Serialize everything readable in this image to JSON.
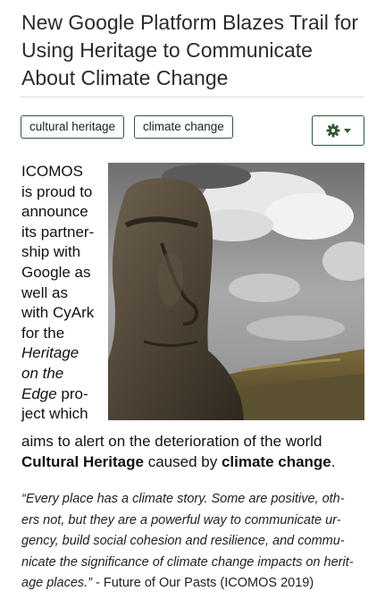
{
  "article": {
    "title": "New Google Platform Blazes Trail for Using Heritage to Communicate About Climate Change"
  },
  "tags": [
    {
      "label": "cultural heritage"
    },
    {
      "label": "climate change"
    }
  ],
  "settings_menu": {
    "icon": "gear-icon",
    "caret": "chevron-down-icon"
  },
  "body": {
    "line1": "ICOMOS",
    "line2": "is proud to",
    "line3": "announce",
    "line4": "its partner-",
    "line5": "ship with",
    "line6": "Google as",
    "line7": "well as",
    "line8": "with CyArk",
    "line9": "for the",
    "line10_em": "Heritage",
    "line11_em": "on the",
    "line12_em": "Edge",
    "line12_rest": " pro-",
    "line13": "ject which",
    "wide1": "aims to alert on the deterioration of the world",
    "bold1": "Cultural Heritage",
    "mid": " caused by ",
    "bold2": "climate change",
    "end": "."
  },
  "quote": {
    "text": "“Every place has a climate story. Some are positive, oth- ers not, but they are a powerful way to communicate ur- gency, build social cohesion and resilience, and commu- nicate the significance of climate change impacts on herit- age places.”",
    "l1": "“Every place has a climate story. Some are positive, oth-",
    "l2": "ers not, but they are a powerful way to communicate ur-",
    "l3": "gency, build social cohesion and resilience, and commu-",
    "l4": "nicate the significance of climate change impacts on herit-",
    "l5": "age places.”",
    "attribution": " - Future of Our Pasts (ICOMOS 2019)"
  },
  "colors": {
    "tag_border": "#2e5a3a",
    "title": "#2b2b2b"
  }
}
